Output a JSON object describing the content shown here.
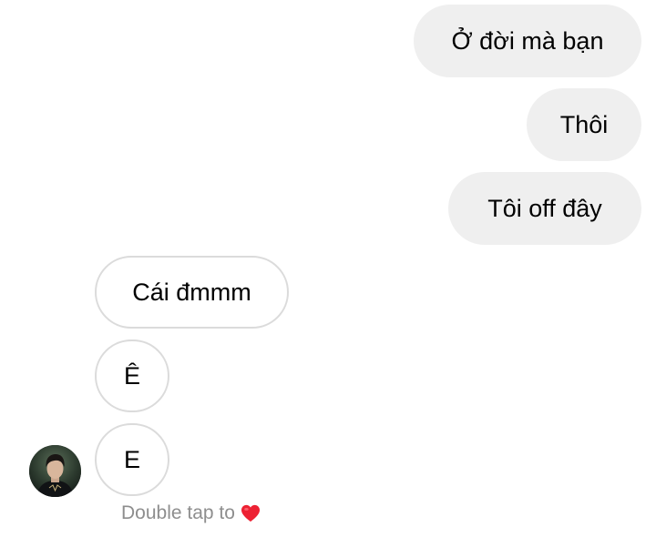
{
  "messages": {
    "sent": [
      "Ở đời mà bạn",
      "Thôi",
      "Tôi off đây"
    ],
    "received": [
      "Cái đmmm",
      "Ê",
      "E"
    ]
  },
  "hint": {
    "text": "Double tap to",
    "icon": "heart-icon",
    "icon_color": "#ed2133"
  },
  "colors": {
    "sent_bubble": "#efefef",
    "received_border": "#dbdbdb",
    "hint_text": "#8e8e8e"
  },
  "avatar": {
    "icon": "avatar"
  }
}
